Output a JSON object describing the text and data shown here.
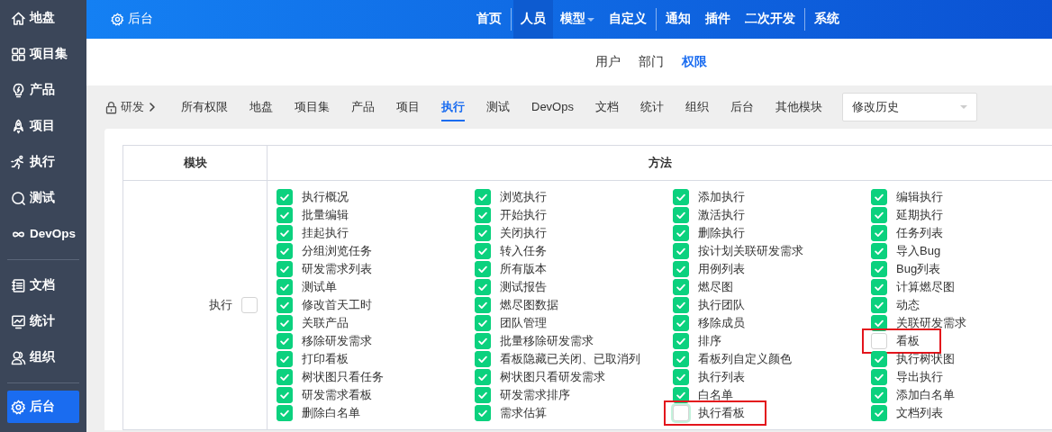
{
  "sidebar": {
    "groups": [
      {
        "items": [
          {
            "label": "地盘",
            "selected": false
          },
          {
            "label": "项目集",
            "selected": false
          },
          {
            "label": "产品",
            "selected": false
          },
          {
            "label": "项目",
            "selected": false
          },
          {
            "label": "执行",
            "selected": false
          },
          {
            "label": "测试",
            "selected": false
          },
          {
            "label": "DevOps",
            "selected": false
          }
        ]
      },
      {
        "items": [
          {
            "label": "文档",
            "selected": false
          },
          {
            "label": "统计",
            "selected": false
          },
          {
            "label": "组织",
            "selected": false
          }
        ]
      },
      {
        "items": [
          {
            "label": "后台",
            "selected": true
          }
        ]
      }
    ]
  },
  "topbar": {
    "brand": "后台",
    "nav_groups": [
      [
        {
          "label": "首页",
          "selected": false,
          "dropdown": false
        }
      ],
      [
        {
          "label": "人员",
          "selected": true,
          "dropdown": false
        },
        {
          "label": "模型",
          "selected": false,
          "dropdown": true
        },
        {
          "label": "自定义",
          "selected": false,
          "dropdown": false
        }
      ],
      [
        {
          "label": "通知",
          "selected": false,
          "dropdown": false
        },
        {
          "label": "插件",
          "selected": false,
          "dropdown": false
        },
        {
          "label": "二次开发",
          "selected": false,
          "dropdown": false
        }
      ],
      [
        {
          "label": "系统",
          "selected": false,
          "dropdown": false
        }
      ]
    ]
  },
  "subnav": [
    {
      "label": "用户",
      "selected": false
    },
    {
      "label": "部门",
      "selected": false
    },
    {
      "label": "权限",
      "selected": true
    }
  ],
  "breadcrumb": {
    "group": "研发"
  },
  "module_tabs": [
    {
      "label": "所有权限",
      "selected": false
    },
    {
      "label": "地盘",
      "selected": false
    },
    {
      "label": "项目集",
      "selected": false
    },
    {
      "label": "产品",
      "selected": false
    },
    {
      "label": "项目",
      "selected": false
    },
    {
      "label": "执行",
      "selected": true
    },
    {
      "label": "测试",
      "selected": false
    },
    {
      "label": "DevOps",
      "selected": false
    },
    {
      "label": "文档",
      "selected": false
    },
    {
      "label": "统计",
      "selected": false
    },
    {
      "label": "组织",
      "selected": false
    },
    {
      "label": "后台",
      "selected": false
    },
    {
      "label": "其他模块",
      "selected": false
    }
  ],
  "history_select": {
    "value": "修改历史"
  },
  "table": {
    "columns": [
      "模块",
      "方法"
    ],
    "module": {
      "label": "执行",
      "checked": false
    },
    "methods": [
      {
        "label": "执行概况",
        "checked": true,
        "highlighted": false
      },
      {
        "label": "浏览执行",
        "checked": true,
        "highlighted": false
      },
      {
        "label": "添加执行",
        "checked": true,
        "highlighted": false
      },
      {
        "label": "编辑执行",
        "checked": true,
        "highlighted": false
      },
      {
        "label": "批量编辑",
        "checked": true,
        "highlighted": false
      },
      {
        "label": "开始执行",
        "checked": true,
        "highlighted": false
      },
      {
        "label": "激活执行",
        "checked": true,
        "highlighted": false
      },
      {
        "label": "延期执行",
        "checked": true,
        "highlighted": false
      },
      {
        "label": "挂起执行",
        "checked": true,
        "highlighted": false
      },
      {
        "label": "关闭执行",
        "checked": true,
        "highlighted": false
      },
      {
        "label": "删除执行",
        "checked": true,
        "highlighted": false
      },
      {
        "label": "任务列表",
        "checked": true,
        "highlighted": false
      },
      {
        "label": "分组浏览任务",
        "checked": true,
        "highlighted": false
      },
      {
        "label": "转入任务",
        "checked": true,
        "highlighted": false
      },
      {
        "label": "按计划关联研发需求",
        "checked": true,
        "highlighted": false
      },
      {
        "label": "导入Bug",
        "checked": true,
        "highlighted": false
      },
      {
        "label": "研发需求列表",
        "checked": true,
        "highlighted": false
      },
      {
        "label": "所有版本",
        "checked": true,
        "highlighted": false
      },
      {
        "label": "用例列表",
        "checked": true,
        "highlighted": false
      },
      {
        "label": "Bug列表",
        "checked": true,
        "highlighted": false
      },
      {
        "label": "测试单",
        "checked": true,
        "highlighted": false
      },
      {
        "label": "测试报告",
        "checked": true,
        "highlighted": false
      },
      {
        "label": "燃尽图",
        "checked": true,
        "highlighted": false
      },
      {
        "label": "计算燃尽图",
        "checked": true,
        "highlighted": false
      },
      {
        "label": "修改首天工时",
        "checked": true,
        "highlighted": false
      },
      {
        "label": "燃尽图数据",
        "checked": true,
        "highlighted": false
      },
      {
        "label": "执行团队",
        "checked": true,
        "highlighted": false
      },
      {
        "label": "动态",
        "checked": true,
        "highlighted": false
      },
      {
        "label": "关联产品",
        "checked": true,
        "highlighted": false
      },
      {
        "label": "团队管理",
        "checked": true,
        "highlighted": false
      },
      {
        "label": "移除成员",
        "checked": true,
        "highlighted": false
      },
      {
        "label": "关联研发需求",
        "checked": true,
        "highlighted": false
      },
      {
        "label": "移除研发需求",
        "checked": true,
        "highlighted": false
      },
      {
        "label": "批量移除研发需求",
        "checked": true,
        "highlighted": false
      },
      {
        "label": "排序",
        "checked": true,
        "highlighted": false
      },
      {
        "label": "看板",
        "checked": false,
        "highlighted": true
      },
      {
        "label": "打印看板",
        "checked": true,
        "highlighted": false
      },
      {
        "label": "看板隐藏已关闭、已取消列",
        "checked": true,
        "highlighted": false
      },
      {
        "label": "看板列自定义颜色",
        "checked": true,
        "highlighted": false
      },
      {
        "label": "执行树状图",
        "checked": true,
        "highlighted": false
      },
      {
        "label": "树状图只看任务",
        "checked": true,
        "highlighted": false
      },
      {
        "label": "树状图只看研发需求",
        "checked": true,
        "highlighted": false
      },
      {
        "label": "执行列表",
        "checked": true,
        "highlighted": false
      },
      {
        "label": "导出执行",
        "checked": true,
        "highlighted": false
      },
      {
        "label": "研发需求看板",
        "checked": true,
        "highlighted": false
      },
      {
        "label": "研发需求排序",
        "checked": true,
        "highlighted": false
      },
      {
        "label": "白名单",
        "checked": true,
        "highlighted": false
      },
      {
        "label": "添加白名单",
        "checked": true,
        "highlighted": false
      },
      {
        "label": "删除白名单",
        "checked": true,
        "highlighted": false
      },
      {
        "label": "需求估算",
        "checked": true,
        "highlighted": false
      },
      {
        "label": "执行看板",
        "checked": false,
        "highlighted": true
      },
      {
        "label": "文档列表",
        "checked": true,
        "highlighted": false
      }
    ]
  }
}
